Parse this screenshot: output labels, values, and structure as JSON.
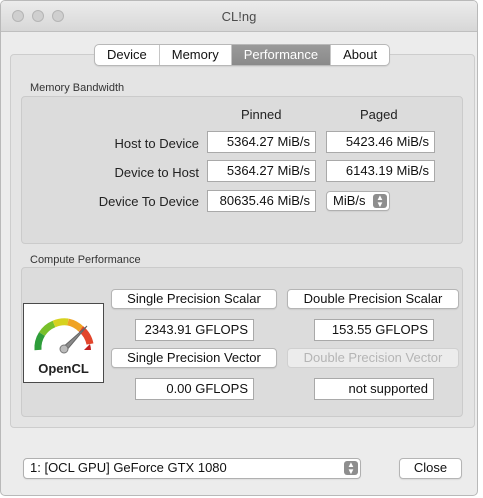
{
  "window": {
    "title": "CL!ng"
  },
  "tabs": [
    {
      "label": "Device"
    },
    {
      "label": "Memory"
    },
    {
      "label": "Performance",
      "active": true
    },
    {
      "label": "About"
    }
  ],
  "memory_bandwidth": {
    "group_label": "Memory Bandwidth",
    "col_pinned": "Pinned",
    "col_paged": "Paged",
    "rows": [
      {
        "label": "Host to Device",
        "pinned": "5364.27 MiB/s",
        "paged": "5423.46 MiB/s"
      },
      {
        "label": "Device to Host",
        "pinned": "5364.27 MiB/s",
        "paged": "6143.19 MiB/s"
      },
      {
        "label": "Device To Device",
        "pinned": "80635.46 MiB/s",
        "unit_select": "MiB/s"
      }
    ]
  },
  "compute_performance": {
    "group_label": "Compute Performance",
    "logo_text": "OpenCL",
    "single_scalar_button": "Single Precision Scalar",
    "double_scalar_button": "Double Precision Scalar",
    "single_scalar_value": "2343.91 GFLOPS",
    "double_scalar_value": "153.55 GFLOPS",
    "single_vector_button": "Single Precision Vector",
    "double_vector_button": "Double Precision Vector",
    "single_vector_value": "0.00 GFLOPS",
    "double_vector_value": "not supported"
  },
  "footer": {
    "device_select": "1: [OCL GPU] GeForce GTX 1080",
    "close_button": "Close"
  },
  "icons": {
    "traffic_lights": "window-control-icons",
    "logo": "opencl-gauge-icon",
    "select_arrows": "up-down-chevron-icon"
  }
}
